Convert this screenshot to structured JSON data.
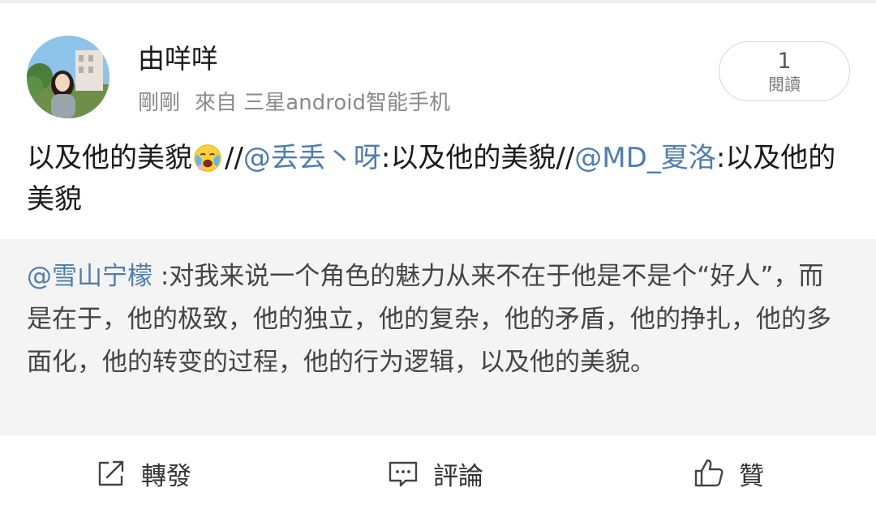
{
  "post": {
    "author": "由咩咩",
    "time": "剛剛",
    "source": "來自 三星android智能手机",
    "read_count": "1",
    "read_label": "閱讀",
    "text": {
      "t1": "以及他的美貌",
      "t2": "//",
      "m1": "@丢丢丶呀",
      "t3": ":以及他的美貌//",
      "m2": "@MD_夏洛",
      "t4": ":以及他的美貌"
    },
    "emoji": "crying-laughing-emoji"
  },
  "quote": {
    "mention": "@雪山宁檬",
    "text": " :对我来说一个角色的魅力从来不在于他是不是个“好人”，而是在于，他的极致，他的独立，他的复杂，他的矛盾，他的挣扎，他的多面化，他的转变的过程，他的行为逻辑，以及他的美貌。"
  },
  "actions": {
    "repost": "轉發",
    "comment": "評論",
    "like": "贊"
  },
  "colors": {
    "mention": "#507daf",
    "quote_bg": "#f4f4f4",
    "meta": "#8a8a8a"
  }
}
